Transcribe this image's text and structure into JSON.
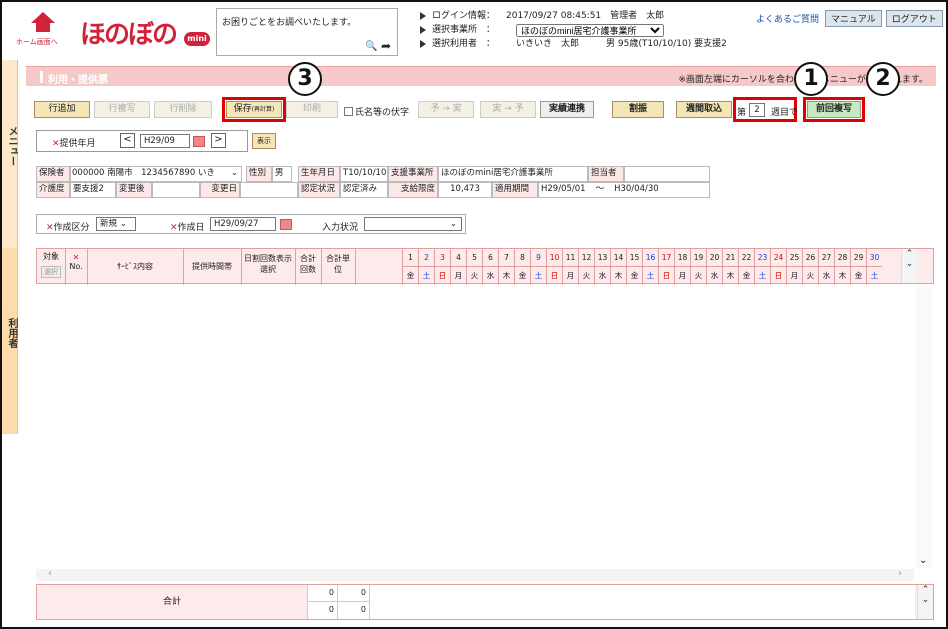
{
  "header": {
    "home_label": "ホーム画面へ",
    "logo_text": "ほのぼの",
    "logo_mini": "mini",
    "help_text": "お困りごとをお調べいたします。",
    "login_label": "ログイン情報：",
    "login_value": "2017/09/27 08:45:51　管理者　太郎",
    "office_label": "選択事業所　：",
    "office_value": "ほのぼのmini居宅介護事業所",
    "user_label": "選択利用者　：",
    "user_value": "いきいき　太郎　　　男 95歳(T10/10/10) 要支援2",
    "faq": "よくあるご質問",
    "manual": "マニュアル",
    "logout": "ログアウト"
  },
  "side": {
    "menu": "メニュー",
    "user": "利用者"
  },
  "title": "利用・提供票",
  "title_note": "※画面左端にカーソルを合わせるとメニューが表示されます。",
  "toolbar": {
    "add_row": "行追加",
    "copy_row": "行複写",
    "delete_row": "行削除",
    "save": "保存",
    "save_sub": "(再計算)",
    "print": "印刷",
    "hide_name": "氏名等の伏字",
    "plan_to_actual": "予 → 実",
    "actual_to_plan": "実 → 予",
    "actual_link": "実績連携",
    "allocate": "割振",
    "weekly": "週間取込",
    "week_prefix": "第",
    "week_no": "2",
    "week_suffix": "週目で",
    "prev_copy": "前回複写"
  },
  "period": {
    "label": "提供年月",
    "value": "H29/09",
    "show": "表示"
  },
  "info_rows": [
    {
      "insurer_label": "保険者",
      "insurer_value": "000000 南陽市　1234567890 いき",
      "sex_label": "性別",
      "sex_value": "男",
      "birth_label": "生年月日",
      "birth_value": "T10/10/10",
      "office_label": "支援事業所",
      "office_value": "ほのぼのmini居宅介護事業所",
      "staff_label": "担当者"
    },
    {
      "care_label": "介護度",
      "care_value": "要支援2",
      "after_label": "変更後",
      "date_label": "変更日",
      "cert_label": "認定状況",
      "cert_value": "認定済み",
      "limit_label": "支給限度",
      "limit_value": "10,473",
      "period_label": "適用期間",
      "period_from": "H29/05/01",
      "tilde": "〜",
      "period_to": "H30/04/30"
    }
  ],
  "create": {
    "type_label": "作成区分",
    "type_value": "新規",
    "date_label": "作成日",
    "date_value": "H29/09/27",
    "input_label": "入力状況"
  },
  "grid": {
    "target": "対象",
    "select": "選択",
    "no": "No.",
    "service": "ｻｰﾋﾞｽ内容",
    "time": "提供時間帯",
    "daily": "日割回数表示選択",
    "total_count": "合計回数",
    "total_unit": "合計単位",
    "days": [
      {
        "d": "1",
        "w": "金"
      },
      {
        "d": "2",
        "w": "土"
      },
      {
        "d": "3",
        "w": "日"
      },
      {
        "d": "4",
        "w": "月"
      },
      {
        "d": "5",
        "w": "火"
      },
      {
        "d": "6",
        "w": "水"
      },
      {
        "d": "7",
        "w": "木"
      },
      {
        "d": "8",
        "w": "金"
      },
      {
        "d": "9",
        "w": "土"
      },
      {
        "d": "10",
        "w": "日"
      },
      {
        "d": "11",
        "w": "月"
      },
      {
        "d": "12",
        "w": "火"
      },
      {
        "d": "13",
        "w": "水"
      },
      {
        "d": "14",
        "w": "木"
      },
      {
        "d": "15",
        "w": "金"
      },
      {
        "d": "16",
        "w": "土"
      },
      {
        "d": "17",
        "w": "日"
      },
      {
        "d": "18",
        "w": "月"
      },
      {
        "d": "19",
        "w": "火"
      },
      {
        "d": "20",
        "w": "水"
      },
      {
        "d": "21",
        "w": "木"
      },
      {
        "d": "22",
        "w": "金"
      },
      {
        "d": "23",
        "w": "土"
      },
      {
        "d": "24",
        "w": "日"
      },
      {
        "d": "25",
        "w": "月"
      },
      {
        "d": "26",
        "w": "火"
      },
      {
        "d": "27",
        "w": "水"
      },
      {
        "d": "28",
        "w": "木"
      },
      {
        "d": "29",
        "w": "金"
      },
      {
        "d": "30",
        "w": "土"
      }
    ]
  },
  "footer": {
    "label": "合計",
    "v1": "0",
    "v2": "0",
    "v3": "0",
    "v4": "0"
  },
  "annotations": [
    "1",
    "2",
    "3"
  ],
  "colors": {
    "brand": "#d0233a",
    "highlight": "#e00000",
    "header_pink": "#f7c8c8"
  }
}
